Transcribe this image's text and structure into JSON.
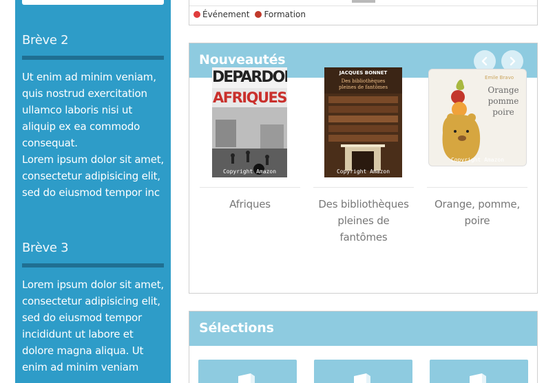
{
  "sidebar": {
    "breves": [
      {
        "title": "Brève 2",
        "paragraphs": [
          "Ut enim ad minim veniam, quis nostrud exercitation ullamco laboris nisi ut aliquip ex ea commodo consequat.",
          "Lorem ipsum dolor sit amet, consectetur adipisicing elit, sed do eiusmod tempor inc"
        ]
      },
      {
        "title": "Brève 3",
        "paragraphs": [
          "Lorem ipsum dolor sit amet, consectetur adipisicing elit, sed do eiusmod tempor incididunt ut labore et dolore magna aliqua. Ut enim ad minim veniam"
        ]
      }
    ]
  },
  "calendar": {
    "legend": [
      {
        "label": "Événement",
        "color": "#e03c3c"
      },
      {
        "label": "Formation",
        "color": "#c0392b"
      }
    ]
  },
  "nouveautes": {
    "title": "Nouveautés",
    "prev_icon": "chevron-left-icon",
    "next_icon": "chevron-right-icon",
    "books": [
      {
        "title": "Afriques",
        "cover_header": "DEPARDON",
        "cover_sub": "AFRIQUES",
        "copyright": "Copyright Amazon"
      },
      {
        "title": "Des bibliothèques pleines de fantômes",
        "cover_header": "JACQUES BONNET",
        "cover_sub": "Des bibliothèques pleines de fantômes",
        "copyright": "Copyright Amazon"
      },
      {
        "title": "Orange, pomme, poire",
        "cover_author": "Emile Bravo",
        "cover_sub": "Orange pomme poire",
        "copyright": "Copyright Amazon"
      }
    ]
  },
  "selections": {
    "title": "Sélections",
    "cards": [
      "book-icon",
      "book-icon",
      "book-icon"
    ]
  },
  "colors": {
    "sidebar_bg": "#2e9cc8",
    "panel_header": "#8ecbe0"
  }
}
